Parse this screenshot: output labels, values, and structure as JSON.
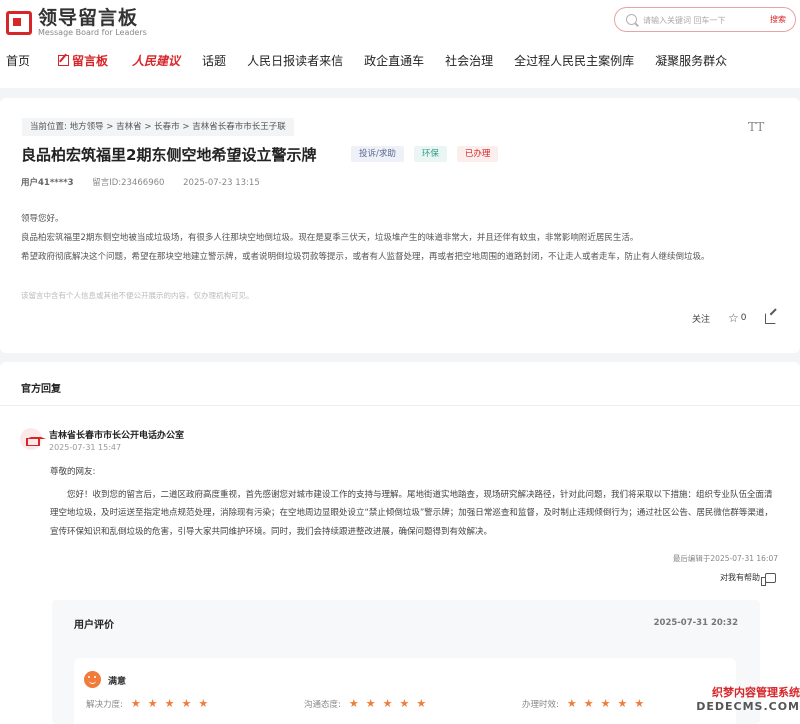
{
  "header": {
    "logo_cn": "领导留言板",
    "logo_en": "Message Board for Leaders",
    "search_placeholder": "请输入关键词 回车一下",
    "search_button": "搜索"
  },
  "nav": {
    "items": [
      "首页",
      "留言板",
      "人民建议",
      "话题",
      "人民日报读者来信",
      "政企直通车",
      "社会治理",
      "全过程人民民主案例库",
      "凝聚服务群众"
    ]
  },
  "message": {
    "breadcrumb_label": "当前位置:",
    "breadcrumb": [
      "地方领导",
      "吉林省",
      "长春市",
      "吉林省长春市市长王子联"
    ],
    "font_toggle": "TT",
    "title": "良品柏宏筑福里2期东侧空地希望设立警示牌",
    "tags": [
      "投诉/求助",
      "环保",
      "已办理"
    ],
    "user": "用户41****3",
    "message_id": "留言ID:23466960",
    "time": "2025-07-23 13:15",
    "greeting": "领导您好。",
    "paragraph1": "良品柏宏筑福里2期东侧空地被当成垃圾场，有很多人往那块空地倒垃圾。现在是夏季三伏天，垃圾堆产生的味道非常大，并且还伴有蚊虫，非常影响附近居民生活。",
    "paragraph2": "希望政府彻底解决这个问题，希望在那块空地建立警示牌，或者说明倒垃圾罚款等提示，或者有人监督处理，再或者把空地周围的道路封闭，不让走人或者走车，防止有人继续倒垃圾。",
    "notice": "该留言中含有个人信息或其他不便公开展示的内容，仅办理机构可见。",
    "follow_label": "关注",
    "star_count": "0"
  },
  "reply": {
    "section_title": "官方回复",
    "org_name": "吉林省长春市市长公开电话办公室",
    "org_time": "2025-07-31 15:47",
    "greeting": "尊敬的网友:",
    "body": "您好！收到您的留言后，二道区政府高度重视，首先感谢您对城市建设工作的支持与理解。尾地街道实地踏查，现场研究解决路径，针对此问题，我们将采取以下措施：组织专业队伍全面清理空地垃圾，及时运送至指定地点规范处理，消除现有污染；在空地周边显眼处设立“禁止倾倒垃圾”警示牌；加强日常巡查和监督，及时制止违规倾倒行为；通过社区公告、居民微信群等渠道，宣传环保知识和乱倒垃圾的危害，引导大家共同维护环境。同时，我们会持续跟进整改进展，确保问题得到有效解决。",
    "edited": "最后编辑于2025-07-31 16:07",
    "helpful_label": "对我有帮助"
  },
  "evaluation": {
    "title": "用户评价",
    "time": "2025-07-31 20:32",
    "result": "满意",
    "ratings": [
      {
        "label": "解决力度:",
        "stars": 5
      },
      {
        "label": "沟通态度:",
        "stars": 5
      },
      {
        "label": "办理时效:",
        "stars": 5
      }
    ]
  },
  "watermark": {
    "line1": "织梦内容管理系统",
    "line2": "DEDECMS.COM"
  },
  "colors": {
    "accent": "#d7262a",
    "star": "#f07b3a",
    "background": "#f3f4f6"
  }
}
